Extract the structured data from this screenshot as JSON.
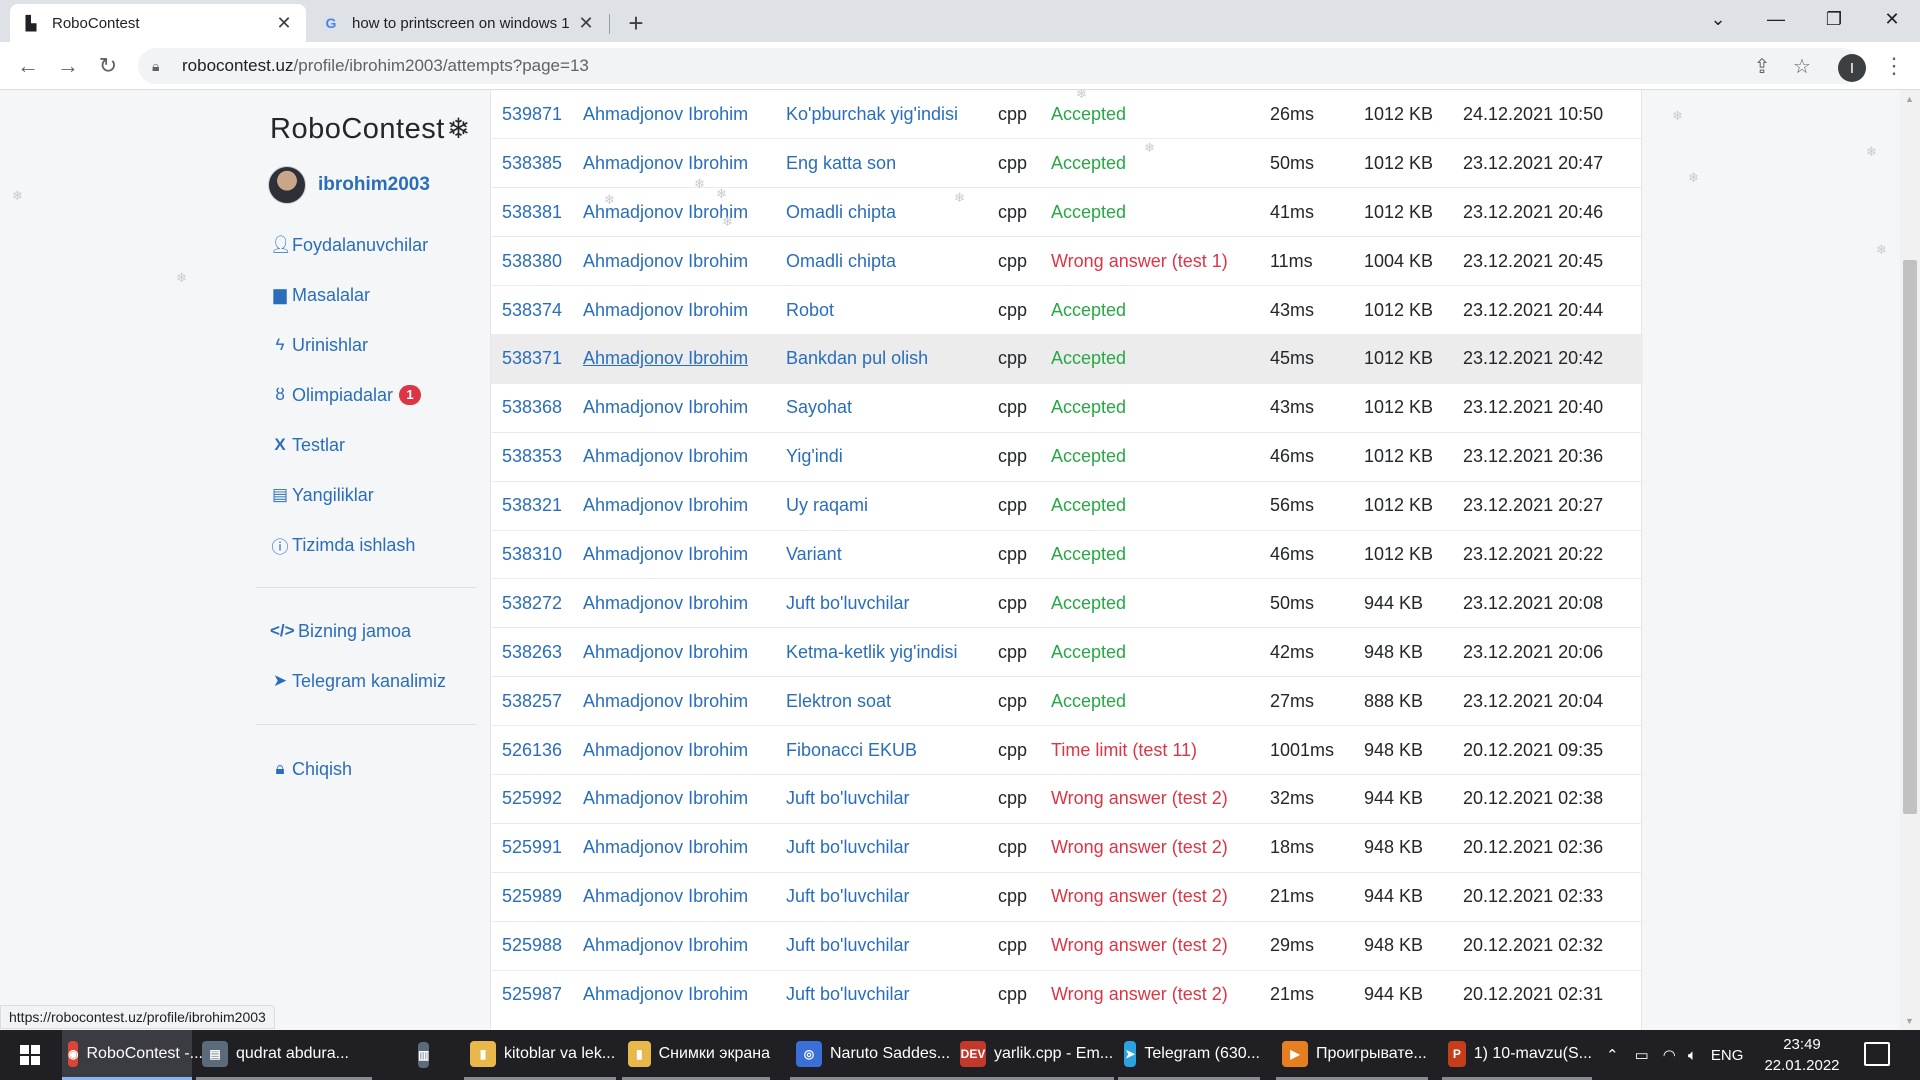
{
  "browser": {
    "tabs": [
      {
        "title": "RoboContest",
        "close": "✕"
      },
      {
        "title": "how to printscreen on windows 1",
        "close": "✕"
      }
    ],
    "new_tab": "+",
    "window_controls": {
      "dropdown": "⌄",
      "minimize": "—",
      "restore": "❐",
      "close": "✕"
    },
    "url_host": "robocontest.uz",
    "url_path": "/profile/ibrohim2003/attempts?page=13",
    "profile_initial": "I",
    "status_url": "https://robocontest.uz/profile/ibrohim2003"
  },
  "sidebar": {
    "brand": "RoboContest",
    "brand_flake": "❄",
    "username": "ibrohim2003",
    "nav": [
      {
        "label": "Foydalanuvchilar",
        "icon": "user-icon"
      },
      {
        "label": "Masalalar",
        "icon": "book-icon"
      },
      {
        "label": "Urinishlar",
        "icon": "bolt-icon"
      },
      {
        "label": "Olimpiadalar",
        "icon": "medal-icon",
        "badge": "1"
      },
      {
        "label": "Testlar",
        "icon": "subscript-icon"
      },
      {
        "label": "Yangiliklar",
        "icon": "newspaper-icon"
      },
      {
        "label": "Tizimda ishlash",
        "icon": "info-icon"
      }
    ],
    "nav2": [
      {
        "label": "Bizning jamoa",
        "icon": "code-icon"
      },
      {
        "label": "Telegram kanalimiz",
        "icon": "telegram-icon"
      }
    ],
    "nav3": [
      {
        "label": "Chiqish",
        "icon": "lock-icon"
      }
    ]
  },
  "attempts": [
    {
      "id": "539871",
      "user": "Ahmadjonov Ibrohim",
      "problem": "Ko'pburchak yig'indisi",
      "lang": "cpp",
      "status": "Accepted",
      "ok": true,
      "time": "26ms",
      "memory": "1012 KB",
      "date": "24.12.2021 10:50"
    },
    {
      "id": "538385",
      "user": "Ahmadjonov Ibrohim",
      "problem": "Eng katta son",
      "lang": "cpp",
      "status": "Accepted",
      "ok": true,
      "time": "50ms",
      "memory": "1012 KB",
      "date": "23.12.2021 20:47"
    },
    {
      "id": "538381",
      "user": "Ahmadjonov Ibrohim",
      "problem": "Omadli chipta",
      "lang": "cpp",
      "status": "Accepted",
      "ok": true,
      "time": "41ms",
      "memory": "1012 KB",
      "date": "23.12.2021 20:46"
    },
    {
      "id": "538380",
      "user": "Ahmadjonov Ibrohim",
      "problem": "Omadli chipta",
      "lang": "cpp",
      "status": "Wrong answer (test 1)",
      "ok": false,
      "time": "11ms",
      "memory": "1004 KB",
      "date": "23.12.2021 20:45"
    },
    {
      "id": "538374",
      "user": "Ahmadjonov Ibrohim",
      "problem": "Robot",
      "lang": "cpp",
      "status": "Accepted",
      "ok": true,
      "time": "43ms",
      "memory": "1012 KB",
      "date": "23.12.2021 20:44"
    },
    {
      "id": "538371",
      "user": "Ahmadjonov Ibrohim",
      "problem": "Bankdan pul olish",
      "lang": "cpp",
      "status": "Accepted",
      "ok": true,
      "time": "45ms",
      "memory": "1012 KB",
      "date": "23.12.2021 20:42"
    },
    {
      "id": "538368",
      "user": "Ahmadjonov Ibrohim",
      "problem": "Sayohat",
      "lang": "cpp",
      "status": "Accepted",
      "ok": true,
      "time": "43ms",
      "memory": "1012 KB",
      "date": "23.12.2021 20:40"
    },
    {
      "id": "538353",
      "user": "Ahmadjonov Ibrohim",
      "problem": "Yig'indi",
      "lang": "cpp",
      "status": "Accepted",
      "ok": true,
      "time": "46ms",
      "memory": "1012 KB",
      "date": "23.12.2021 20:36"
    },
    {
      "id": "538321",
      "user": "Ahmadjonov Ibrohim",
      "problem": "Uy raqami",
      "lang": "cpp",
      "status": "Accepted",
      "ok": true,
      "time": "56ms",
      "memory": "1012 KB",
      "date": "23.12.2021 20:27"
    },
    {
      "id": "538310",
      "user": "Ahmadjonov Ibrohim",
      "problem": "Variant",
      "lang": "cpp",
      "status": "Accepted",
      "ok": true,
      "time": "46ms",
      "memory": "1012 KB",
      "date": "23.12.2021 20:22"
    },
    {
      "id": "538272",
      "user": "Ahmadjonov Ibrohim",
      "problem": "Juft bo'luvchilar",
      "lang": "cpp",
      "status": "Accepted",
      "ok": true,
      "time": "50ms",
      "memory": "944 KB",
      "date": "23.12.2021 20:08"
    },
    {
      "id": "538263",
      "user": "Ahmadjonov Ibrohim",
      "problem": "Ketma-ketlik yig'indisi",
      "lang": "cpp",
      "status": "Accepted",
      "ok": true,
      "time": "42ms",
      "memory": "948 KB",
      "date": "23.12.2021 20:06"
    },
    {
      "id": "538257",
      "user": "Ahmadjonov Ibrohim",
      "problem": "Elektron soat",
      "lang": "cpp",
      "status": "Accepted",
      "ok": true,
      "time": "27ms",
      "memory": "888 KB",
      "date": "23.12.2021 20:04"
    },
    {
      "id": "526136",
      "user": "Ahmadjonov Ibrohim",
      "problem": "Fibonacci EKUB",
      "lang": "cpp",
      "status": "Time limit (test 11)",
      "ok": false,
      "time": "1001ms",
      "memory": "948 KB",
      "date": "20.12.2021 09:35"
    },
    {
      "id": "525992",
      "user": "Ahmadjonov Ibrohim",
      "problem": "Juft bo'luvchilar",
      "lang": "cpp",
      "status": "Wrong answer (test 2)",
      "ok": false,
      "time": "32ms",
      "memory": "944 KB",
      "date": "20.12.2021 02:38"
    },
    {
      "id": "525991",
      "user": "Ahmadjonov Ibrohim",
      "problem": "Juft bo'luvchilar",
      "lang": "cpp",
      "status": "Wrong answer (test 2)",
      "ok": false,
      "time": "18ms",
      "memory": "948 KB",
      "date": "20.12.2021 02:36"
    },
    {
      "id": "525989",
      "user": "Ahmadjonov Ibrohim",
      "problem": "Juft bo'luvchilar",
      "lang": "cpp",
      "status": "Wrong answer (test 2)",
      "ok": false,
      "time": "21ms",
      "memory": "944 KB",
      "date": "20.12.2021 02:33"
    },
    {
      "id": "525988",
      "user": "Ahmadjonov Ibrohim",
      "problem": "Juft bo'luvchilar",
      "lang": "cpp",
      "status": "Wrong answer (test 2)",
      "ok": false,
      "time": "29ms",
      "memory": "948 KB",
      "date": "20.12.2021 02:32"
    },
    {
      "id": "525987",
      "user": "Ahmadjonov Ibrohim",
      "problem": "Juft bo'luvchilar",
      "lang": "cpp",
      "status": "Wrong answer (test 2)",
      "ok": false,
      "time": "21ms",
      "memory": "944 KB",
      "date": "20.12.2021 02:31"
    }
  ],
  "taskbar": {
    "items": [
      {
        "label": "RoboContest -...",
        "icon": "chrome-icon",
        "color": "#db4437",
        "glyph": "◉"
      },
      {
        "label": "qudrat abdura...",
        "icon": "book-app-icon",
        "color": "#5c6b7a",
        "glyph": "▤"
      },
      {
        "label": "",
        "icon": "app-icon",
        "color": "#5c6b7a",
        "glyph": "▥"
      },
      {
        "label": "kitoblar va lek...",
        "icon": "folder-icon",
        "color": "#e8b84a",
        "glyph": "▮"
      },
      {
        "label": "Снимки экрана",
        "icon": "folder-icon",
        "color": "#e8b84a",
        "glyph": "▮"
      },
      {
        "label": "Naruto Saddes...",
        "icon": "browser-icon",
        "color": "#3b6fd8",
        "glyph": "◎"
      },
      {
        "label": "yarlik.cpp - Em...",
        "icon": "devcpp-icon",
        "color": "#c0392b",
        "glyph": "DEV"
      },
      {
        "label": "Telegram (630...",
        "icon": "telegram-icon",
        "color": "#2aa3e0",
        "glyph": "➤"
      },
      {
        "label": "Проигрывате...",
        "icon": "player-icon",
        "color": "#e67e22",
        "glyph": "▶"
      },
      {
        "label": "1) 10-mavzu(S...",
        "icon": "powerpoint-icon",
        "color": "#c43e1c",
        "glyph": "P"
      }
    ],
    "lang": "ENG",
    "time": "23:49",
    "date": "22.01.2022"
  }
}
